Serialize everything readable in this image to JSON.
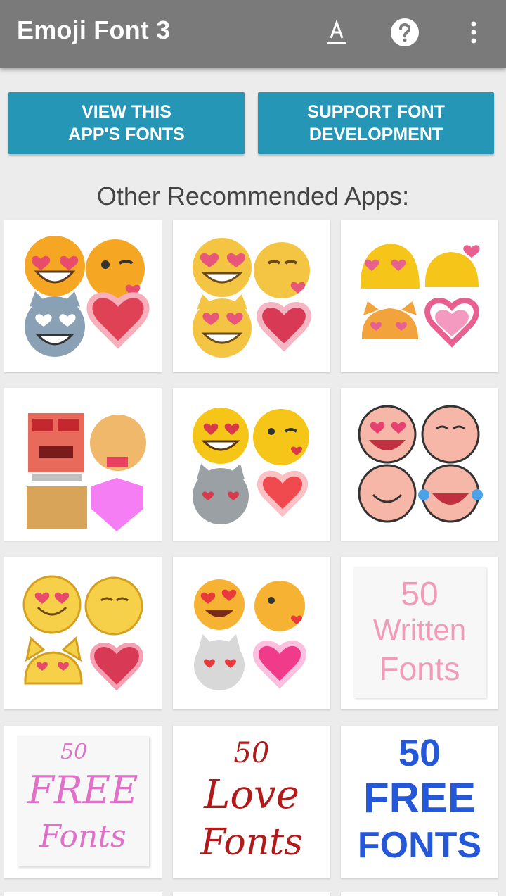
{
  "app_bar": {
    "title": "Emoji Font 3",
    "icons": [
      "font-size-icon",
      "help-icon",
      "more-vert-icon"
    ]
  },
  "actions": {
    "view_fonts": "VIEW THIS APP'S FONTS",
    "support": "SUPPORT FONT DEVELOPMENT"
  },
  "section_title": "Other Recommended Apps:",
  "colors": {
    "appbar": "#7a7a7a",
    "button": "#2596b5",
    "background": "#ececec"
  },
  "apps": [
    {
      "name": "emoji-pack-1-thumbnail"
    },
    {
      "name": "emoji-pack-2-thumbnail"
    },
    {
      "name": "emoji-pack-3-thumbnail"
    },
    {
      "name": "emoji-pack-pixel-thumbnail"
    },
    {
      "name": "emoji-pack-5-thumbnail"
    },
    {
      "name": "emoji-pack-pink-thumbnail"
    },
    {
      "name": "emoji-pack-7-thumbnail"
    },
    {
      "name": "emoji-pack-8-thumbnail"
    },
    {
      "name": "written-fonts-thumbnail",
      "line1": "50",
      "line2": "Written",
      "line3": "Fonts"
    },
    {
      "name": "free-fonts-script-thumbnail",
      "line1": "50",
      "line2": "FREE",
      "line3": "Fonts"
    },
    {
      "name": "love-fonts-thumbnail",
      "line1": "50",
      "line2": "Love",
      "line3": "Fonts"
    },
    {
      "name": "free-fonts-drip-thumbnail",
      "line1": "50",
      "line2": "FREE",
      "line3": "FONTS"
    }
  ]
}
